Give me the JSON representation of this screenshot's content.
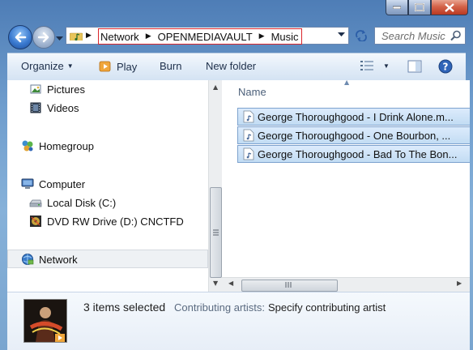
{
  "address_bar": {
    "crumbs": [
      "Network",
      "OPENMEDIAVAULT",
      "Music"
    ]
  },
  "search": {
    "placeholder": "Search Music"
  },
  "toolbar": {
    "organize": "Organize",
    "play": "Play",
    "burn": "Burn",
    "new_folder": "New folder"
  },
  "nav_pane": {
    "pictures": "Pictures",
    "videos": "Videos",
    "homegroup": "Homegroup",
    "computer": "Computer",
    "local_disk": "Local Disk (C:)",
    "dvd_drive": "DVD RW Drive (D:) CNCTFD",
    "network": "Network"
  },
  "file_list": {
    "column_name": "Name",
    "files": [
      "George Thoroughgood - I Drink Alone.m...",
      "George Thoroughgood -  One Bourbon, ...",
      "George Thoroughgood - Bad To The Bon..."
    ]
  },
  "details_pane": {
    "selection_count": "3 items selected",
    "property_label": "Contributing artists:",
    "property_value": "Specify contributing artist"
  },
  "icons": {
    "back": "back-arrow-icon",
    "forward": "forward-arrow-icon",
    "refresh": "refresh-icon",
    "search": "search-icon",
    "help": "help-icon"
  },
  "colors": {
    "selection_fill": "#c2dcf3",
    "selection_border": "#7da2ce",
    "crumb_highlight": "#d9262b",
    "toolbar_bg": "#e3edf8"
  }
}
